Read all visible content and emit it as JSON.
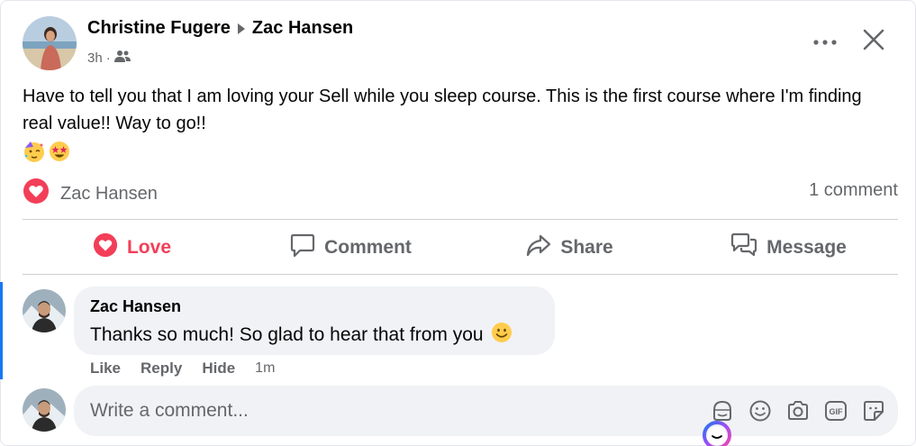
{
  "post": {
    "author": "Christine Fugere",
    "recipient": "Zac Hansen",
    "time": "3h",
    "separator": "·",
    "text": "Have to tell you that I am loving your Sell while you sleep course.  This is the first course where I'm finding real value!! Way to go!!",
    "emojis": [
      "partying-face-emoji",
      "star-struck-emoji"
    ]
  },
  "reactions": {
    "names": "Zac Hansen",
    "comment_count": "1 comment"
  },
  "actions": {
    "love": "Love",
    "comment": "Comment",
    "share": "Share",
    "message": "Message"
  },
  "comment": {
    "author": "Zac Hansen",
    "text": "Thanks so much! So glad to hear that from you",
    "like": "Like",
    "reply": "Reply",
    "hide": "Hide",
    "time": "1m"
  },
  "composer": {
    "placeholder": "Write a comment..."
  },
  "colors": {
    "love": "#f33e58",
    "accent": "#1877f2",
    "muted": "#65676b",
    "bubble": "#f0f2f5"
  }
}
